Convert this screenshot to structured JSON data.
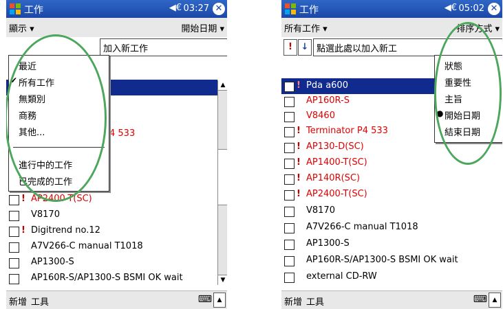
{
  "left": {
    "title": "工作",
    "time": "03:27",
    "menu_left": "顯示 ▾",
    "menu_right": "開始日期 ▾",
    "add_task": "加入新工作",
    "dropdown": [
      {
        "label": "最近",
        "mark": ""
      },
      {
        "label": "所有工作",
        "mark": "✔"
      },
      {
        "label": "無類別",
        "mark": ""
      },
      {
        "label": "商務",
        "mark": ""
      },
      {
        "label": "其他...",
        "mark": ""
      },
      {
        "label": "進行中的工作",
        "mark": ""
      },
      {
        "label": "已完成的工作",
        "mark": ""
      }
    ],
    "peek": {
      "row1": "4 533",
      "row2": ")"
    },
    "tasks": [
      {
        "text": "AP2400-T(SC)",
        "excl": "!",
        "red": true
      },
      {
        "text": "V8170",
        "excl": "",
        "red": false
      },
      {
        "text": "Digitrend no.12",
        "excl": "!",
        "red": false
      },
      {
        "text": "A7V266-C manual T1018",
        "excl": "",
        "red": false
      },
      {
        "text": "AP1300-S",
        "excl": "",
        "red": false
      },
      {
        "text": "AP160R-S/AP1300-S BSMI OK wait",
        "excl": "",
        "red": false
      }
    ],
    "bottom_new": "新增",
    "bottom_tools": "工具"
  },
  "right": {
    "title": "工作",
    "time": "05:02",
    "menu_left": "所有工作 ▾",
    "menu_right": "排序方式 ▾",
    "sort_up": "!",
    "sort_down": "↓",
    "add_task": "點選此處以加入新工",
    "dropdown": [
      {
        "label": "狀態",
        "mark": ""
      },
      {
        "label": "重要性",
        "mark": ""
      },
      {
        "label": "主旨",
        "mark": ""
      },
      {
        "label": "開始日期",
        "mark": "●"
      },
      {
        "label": "結束日期",
        "mark": ""
      }
    ],
    "tasks": [
      {
        "text": "Pda a600",
        "excl": "!",
        "red": false,
        "selected": true
      },
      {
        "text": "AP160R-S",
        "excl": "",
        "red": true
      },
      {
        "text": "V8460",
        "excl": "",
        "red": true
      },
      {
        "text": "Terminator P4 533",
        "excl": "!",
        "red": true
      },
      {
        "text": "AP130-D(SC)",
        "excl": "!",
        "red": true
      },
      {
        "text": "AP1400-T(SC)",
        "excl": "!",
        "red": true
      },
      {
        "text": "AP140R(SC)",
        "excl": "!",
        "red": true
      },
      {
        "text": "AP2400-T(SC)",
        "excl": "!",
        "red": true
      },
      {
        "text": "V8170",
        "excl": "",
        "red": false
      },
      {
        "text": "A7V266-C manual T1018",
        "excl": "",
        "red": false
      },
      {
        "text": "AP1300-S",
        "excl": "",
        "red": false
      },
      {
        "text": "AP160R-S/AP1300-S BSMI OK wait",
        "excl": "",
        "red": false
      },
      {
        "text": "external  CD-RW",
        "excl": "",
        "red": false
      }
    ],
    "bottom_new": "新增",
    "bottom_tools": "工具"
  },
  "colors": {
    "titlebar": "#1b47a6",
    "overdue": "#e00000",
    "selection": "#102a8e",
    "highlight_ellipse": "#4ca65c"
  },
  "icons": [
    "windows-logo-icon",
    "speaker-icon",
    "close-icon",
    "keyboard-icon"
  ]
}
